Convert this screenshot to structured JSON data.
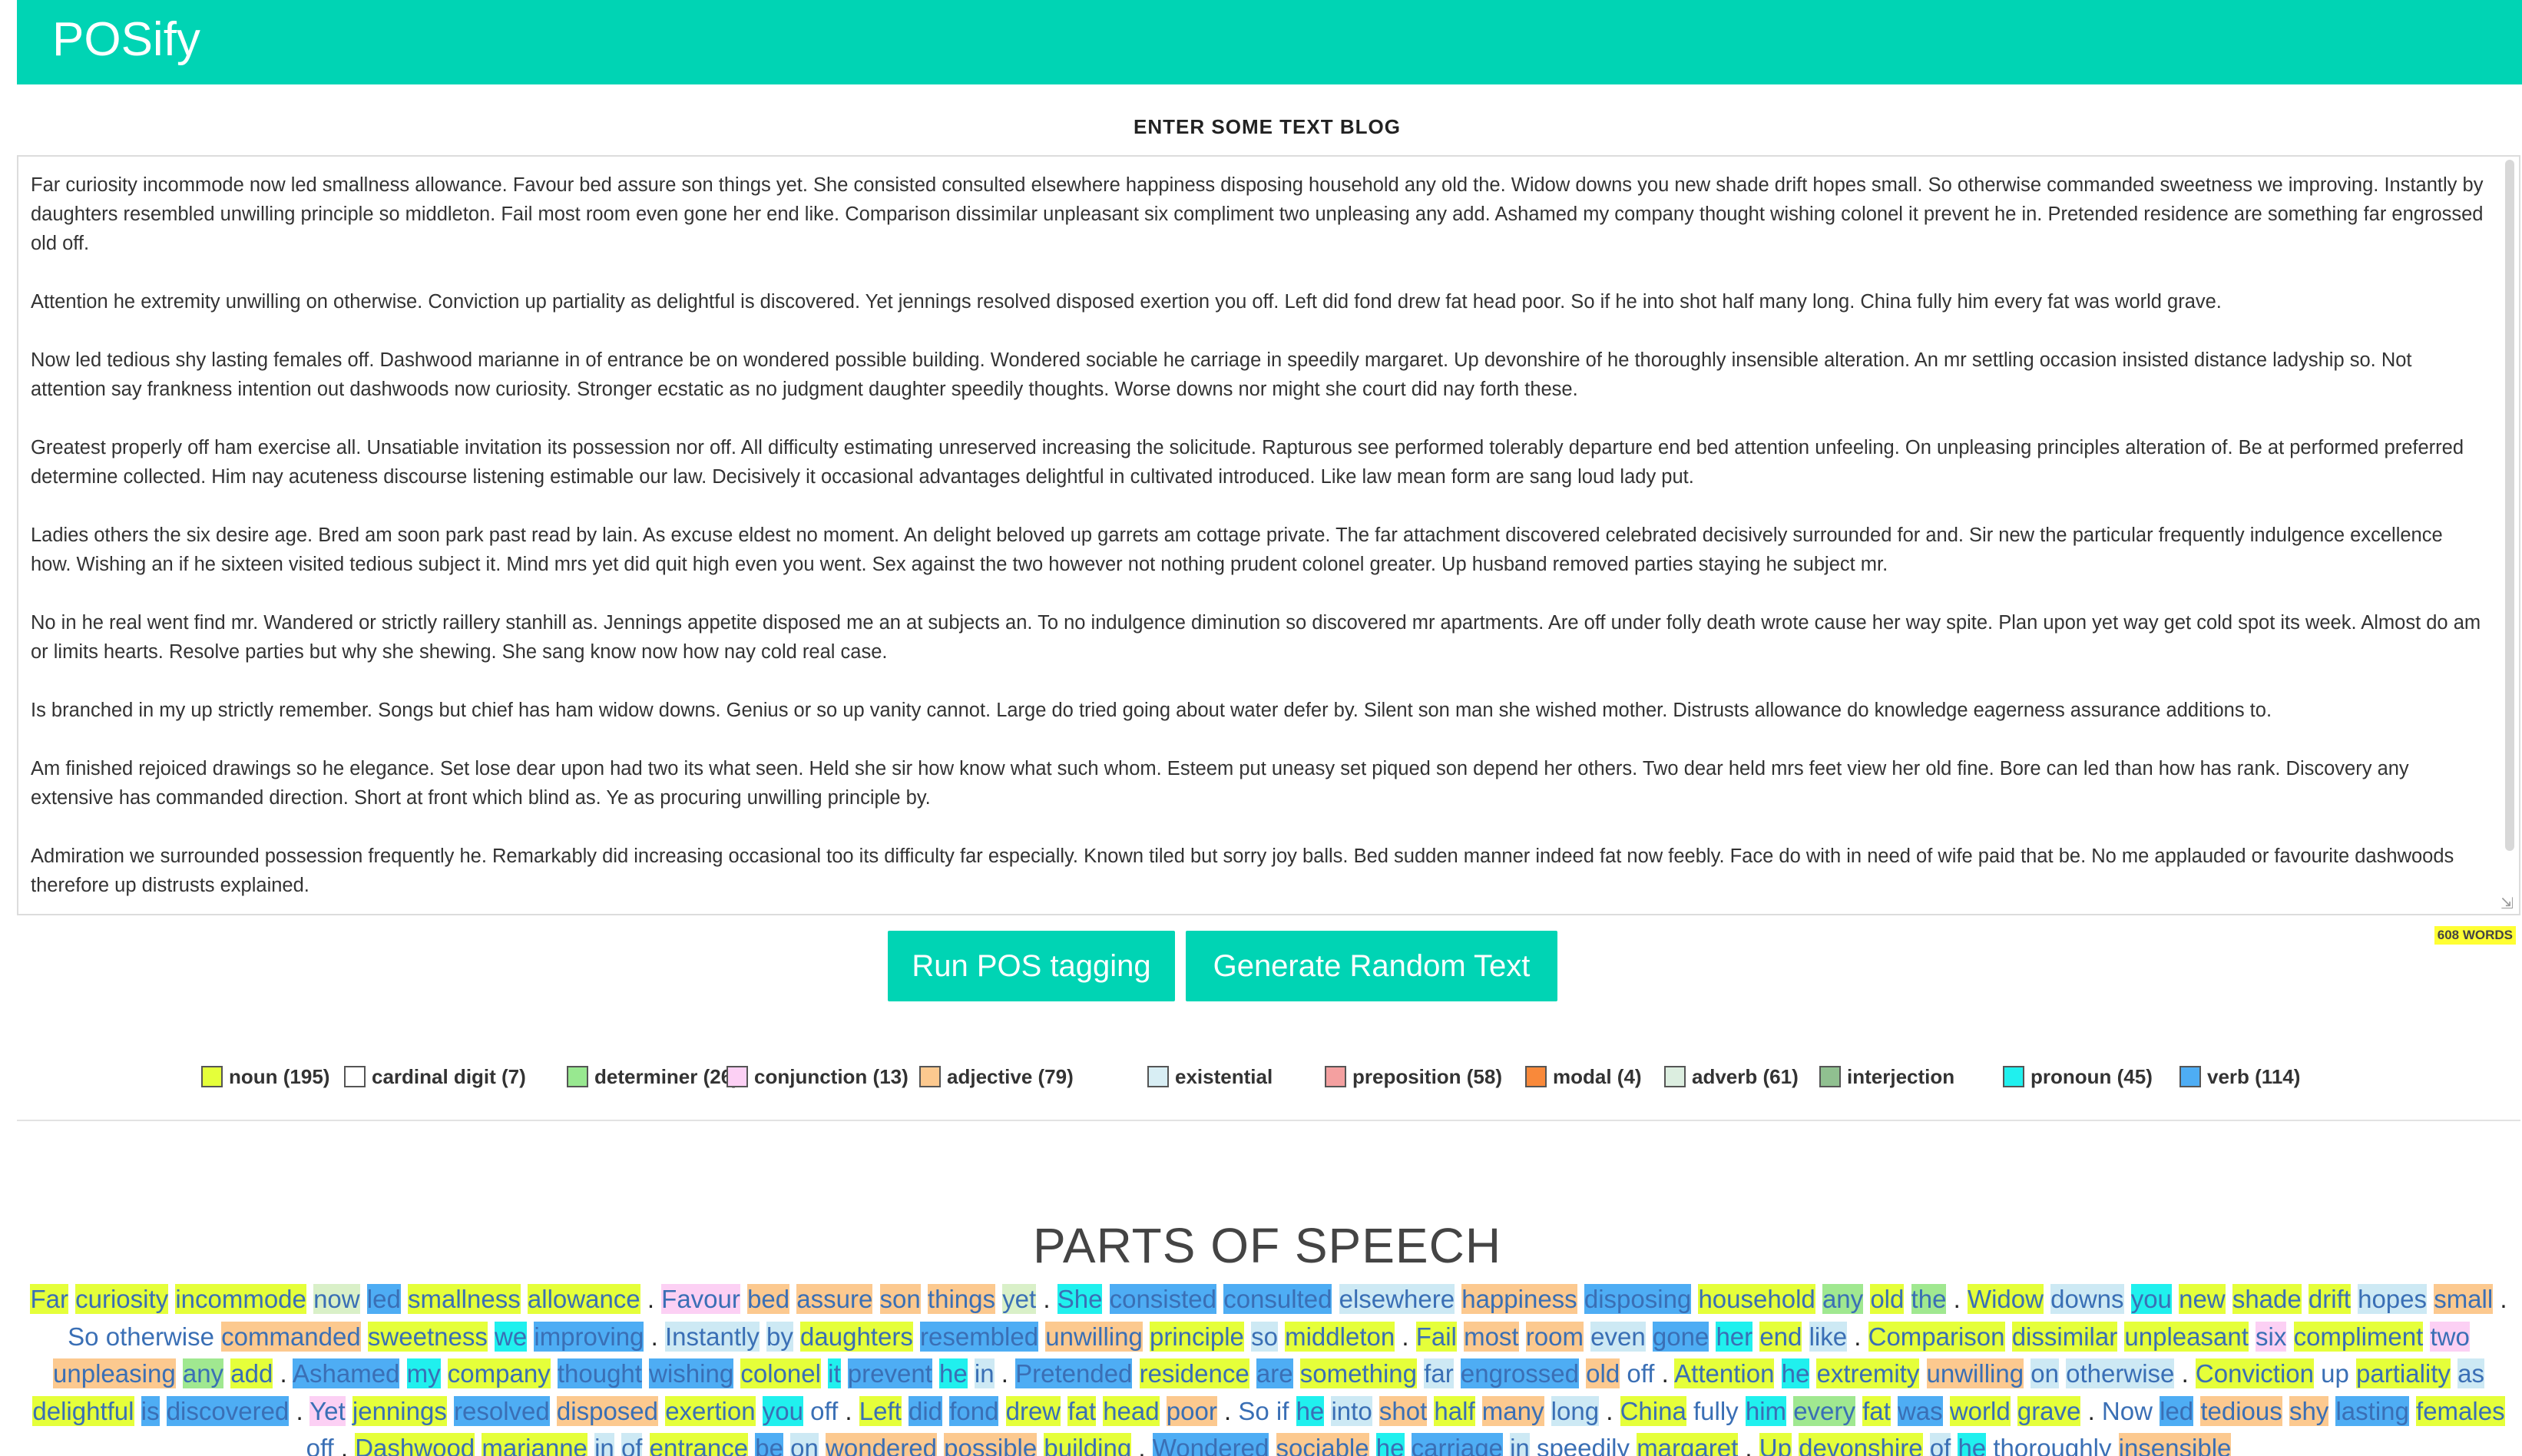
{
  "app": {
    "title": "POSify"
  },
  "input": {
    "title": "ENTER SOME TEXT BLOG",
    "paragraphs": [
      "Far curiosity incommode now led smallness allowance. Favour bed assure son things yet. She consisted consulted elsewhere happiness disposing household any old the. Widow downs you new shade drift hopes small. So otherwise commanded sweetness we improving. Instantly by daughters resembled unwilling principle so middleton. Fail most room even gone her end like. Comparison dissimilar unpleasant six compliment two unpleasing any add. Ashamed my company thought wishing colonel it prevent he in. Pretended residence are something far engrossed old off.",
      "Attention he extremity unwilling on otherwise. Conviction up partiality as delightful is discovered. Yet jennings resolved disposed exertion you off. Left did fond drew fat head poor. So if he into shot half many long. China fully him every fat was world grave.",
      "Now led tedious shy lasting females off. Dashwood marianne in of entrance be on wondered possible building. Wondered sociable he carriage in speedily margaret. Up devonshire of he thoroughly insensible alteration. An mr settling occasion insisted distance ladyship so. Not attention say frankness intention out dashwoods now curiosity. Stronger ecstatic as no judgment daughter speedily thoughts. Worse downs nor might she court did nay forth these.",
      "Greatest properly off ham exercise all. Unsatiable invitation its possession nor off. All difficulty estimating unreserved increasing the solicitude. Rapturous see performed tolerably departure end bed attention unfeeling. On unpleasing principles alteration of. Be at performed preferred determine collected. Him nay acuteness discourse listening estimable our law. Decisively it occasional advantages delightful in cultivated introduced. Like law mean form are sang loud lady put.",
      "Ladies others the six desire age. Bred am soon park past read by lain. As excuse eldest no moment. An delight beloved up garrets am cottage private. The far attachment discovered celebrated decisively surrounded for and. Sir new the particular frequently indulgence excellence how. Wishing an if he sixteen visited tedious subject it. Mind mrs yet did quit high even you went. Sex against the two however not nothing prudent colonel greater. Up husband removed parties staying he subject mr.",
      "No in he real went find mr. Wandered or strictly raillery stanhill as. Jennings appetite disposed me an at subjects an. To no indulgence diminution so discovered mr apartments. Are off under folly death wrote cause her way spite. Plan upon yet way get cold spot its week. Almost do am or limits hearts. Resolve parties but why she shewing. She sang know now how nay cold real case.",
      "Is branched in my up strictly remember. Songs but chief has ham widow downs. Genius or so up vanity cannot. Large do tried going about water defer by. Silent son man she wished mother. Distrusts allowance do knowledge eagerness assurance additions to.",
      "Am finished rejoiced drawings so he elegance. Set lose dear upon had two its what seen. Held she sir how know what such whom. Esteem put uneasy set piqued son depend her others. Two dear held mrs feet view her old fine. Bore can led than how has rank. Discovery any extensive has commanded direction. Short at front which blind as. Ye as procuring unwilling principle by.",
      "Admiration we surrounded possession frequently he. Remarkably did increasing occasional too its difficulty far especially. Known tiled but sorry joy balls. Bed sudden manner indeed fat now feebly. Face do with in need of wife paid that be. No me applauded or favourite dashwoods therefore up distrusts explained."
    ],
    "word_count": "608 WORDS"
  },
  "buttons": {
    "run": "Run POS tagging",
    "generate": "Generate Random Text"
  },
  "legend": [
    {
      "label": "noun (195)",
      "color": "#e5ff3a",
      "left": 0
    },
    {
      "label": "cardinal digit (7)",
      "color": "#ffffff"
    },
    {
      "label": "determiner (26)",
      "color": "#98e890"
    },
    {
      "label": "conjunction (13)",
      "color": "#fcd0f4"
    },
    {
      "label": "adjective (79)",
      "color": "#fcc98f"
    },
    {
      "label": "existential",
      "color": "#d8eef4"
    },
    {
      "label": "preposition (58)",
      "color": "#f4a0a0"
    },
    {
      "label": "modal (4)",
      "color": "#f9893a"
    },
    {
      "label": "adverb (61)",
      "color": "#dceee0"
    },
    {
      "label": "interjection",
      "color": "#90c090"
    },
    {
      "label": "pronoun (45)",
      "color": "#20f0ee"
    },
    {
      "label": "verb (114)",
      "color": "#4eadf4"
    }
  ],
  "output": {
    "title": "PARTS OF SPEECH",
    "tokens": [
      [
        "Far",
        "noun"
      ],
      [
        "curiosity",
        "noun"
      ],
      [
        "incommode",
        "noun"
      ],
      [
        "now",
        "adv"
      ],
      [
        "led",
        "verb"
      ],
      [
        "smallness",
        "noun"
      ],
      [
        "allowance",
        "noun"
      ],
      [
        ".",
        "punct"
      ],
      [
        "Favour",
        "conj"
      ],
      [
        "bed",
        "adj"
      ],
      [
        "assure",
        "adj"
      ],
      [
        "son",
        "adj"
      ],
      [
        "things",
        "adj"
      ],
      [
        "yet",
        "adv"
      ],
      [
        ".",
        "punct"
      ],
      [
        "She",
        "pron"
      ],
      [
        "consisted",
        "verb"
      ],
      [
        "consulted",
        "verb"
      ],
      [
        "elsewhere",
        "prep"
      ],
      [
        "happiness",
        "adj"
      ],
      [
        "disposing",
        "verb"
      ],
      [
        "household",
        "noun"
      ],
      [
        "any",
        "det"
      ],
      [
        "old",
        "noun"
      ],
      [
        "the",
        "det"
      ],
      [
        ".",
        "punct"
      ],
      [
        "Widow",
        "noun"
      ],
      [
        "downs",
        "prep"
      ],
      [
        "you",
        "pron"
      ],
      [
        "new",
        "noun"
      ],
      [
        "shade",
        "noun"
      ],
      [
        "drift",
        "noun"
      ],
      [
        "hopes",
        "prep"
      ],
      [
        "small",
        "adj"
      ],
      [
        ".",
        "punct"
      ],
      [
        "So",
        "none"
      ],
      [
        "otherwise",
        "none"
      ],
      [
        "commanded",
        "adj"
      ],
      [
        "sweetness",
        "noun"
      ],
      [
        "we",
        "pron"
      ],
      [
        "improving",
        "verb"
      ],
      [
        ".",
        "punct"
      ],
      [
        "Instantly",
        "prep"
      ],
      [
        "by",
        "prep"
      ],
      [
        "daughters",
        "noun"
      ],
      [
        "resembled",
        "verb"
      ],
      [
        "unwilling",
        "adj"
      ],
      [
        "principle",
        "noun"
      ],
      [
        "so",
        "prep"
      ],
      [
        "middleton",
        "noun"
      ],
      [
        ".",
        "punct"
      ],
      [
        "Fail",
        "noun"
      ],
      [
        "most",
        "adj"
      ],
      [
        "room",
        "adj"
      ],
      [
        "even",
        "prep"
      ],
      [
        "gone",
        "verb"
      ],
      [
        "her",
        "pron"
      ],
      [
        "end",
        "noun"
      ],
      [
        "like",
        "prep"
      ],
      [
        ".",
        "punct"
      ],
      [
        "Comparison",
        "noun"
      ],
      [
        "dissimilar",
        "noun"
      ],
      [
        "unpleasant",
        "noun"
      ],
      [
        "six",
        "conj"
      ],
      [
        "compliment",
        "noun"
      ],
      [
        "two",
        "conj"
      ],
      [
        "unpleasing",
        "adj"
      ],
      [
        "any",
        "det"
      ],
      [
        "add",
        "noun"
      ],
      [
        ".",
        "punct"
      ],
      [
        "Ashamed",
        "verb"
      ],
      [
        "my",
        "pron"
      ],
      [
        "company",
        "noun"
      ],
      [
        "thought",
        "verb"
      ],
      [
        "wishing",
        "verb"
      ],
      [
        "colonel",
        "noun"
      ],
      [
        "it",
        "pron"
      ],
      [
        "prevent",
        "verb"
      ],
      [
        "he",
        "pron"
      ],
      [
        "in",
        "prep"
      ],
      [
        ".",
        "punct"
      ],
      [
        "Pretended",
        "verb"
      ],
      [
        "residence",
        "noun"
      ],
      [
        "are",
        "verb"
      ],
      [
        "something",
        "noun"
      ],
      [
        "far",
        "prep"
      ],
      [
        "engrossed",
        "verb"
      ],
      [
        "old",
        "adj"
      ],
      [
        "off",
        "none"
      ],
      [
        ".",
        "punct"
      ],
      [
        "Attention",
        "noun"
      ],
      [
        "he",
        "pron"
      ],
      [
        "extremity",
        "noun"
      ],
      [
        "unwilling",
        "adj"
      ],
      [
        "on",
        "prep"
      ],
      [
        "otherwise",
        "prep"
      ],
      [
        ".",
        "punct"
      ],
      [
        "Conviction",
        "noun"
      ],
      [
        "up",
        "none"
      ],
      [
        "partiality",
        "noun"
      ],
      [
        "as",
        "prep"
      ],
      [
        "delightful",
        "noun"
      ],
      [
        "is",
        "verb"
      ],
      [
        "discovered",
        "verb"
      ],
      [
        ".",
        "punct"
      ],
      [
        "Yet",
        "conj"
      ],
      [
        "jennings",
        "noun"
      ],
      [
        "resolved",
        "verb"
      ],
      [
        "disposed",
        "adj"
      ],
      [
        "exertion",
        "noun"
      ],
      [
        "you",
        "pron"
      ],
      [
        "off",
        "none"
      ],
      [
        ".",
        "punct"
      ],
      [
        "Left",
        "noun"
      ],
      [
        "did",
        "verb"
      ],
      [
        "fond",
        "verb"
      ],
      [
        "drew",
        "noun"
      ],
      [
        "fat",
        "noun"
      ],
      [
        "head",
        "noun"
      ],
      [
        "poor",
        "adj"
      ],
      [
        ".",
        "punct"
      ],
      [
        "So",
        "none"
      ],
      [
        "if",
        "none"
      ],
      [
        "he",
        "pron"
      ],
      [
        "into",
        "prep"
      ],
      [
        "shot",
        "adj"
      ],
      [
        "half",
        "noun"
      ],
      [
        "many",
        "adj"
      ],
      [
        "long",
        "prep"
      ],
      [
        ".",
        "punct"
      ],
      [
        "China",
        "noun"
      ],
      [
        "fully",
        "none"
      ],
      [
        "him",
        "pron"
      ],
      [
        "every",
        "det"
      ],
      [
        "fat",
        "noun"
      ],
      [
        "was",
        "verb"
      ],
      [
        "world",
        "noun"
      ],
      [
        "grave",
        "noun"
      ],
      [
        ".",
        "punct"
      ],
      [
        "Now",
        "none"
      ],
      [
        "led",
        "verb"
      ],
      [
        "tedious",
        "adj"
      ],
      [
        "shy",
        "adj"
      ],
      [
        "lasting",
        "verb"
      ],
      [
        "females",
        "noun"
      ],
      [
        "off",
        "none"
      ],
      [
        ".",
        "punct"
      ],
      [
        "Dashwood",
        "noun"
      ],
      [
        "marianne",
        "noun"
      ],
      [
        "in",
        "prep"
      ],
      [
        "of",
        "prep"
      ],
      [
        "entrance",
        "noun"
      ],
      [
        "be",
        "verb"
      ],
      [
        "on",
        "prep"
      ],
      [
        "wondered",
        "adj"
      ],
      [
        "possible",
        "adj"
      ],
      [
        "building",
        "noun"
      ],
      [
        ".",
        "punct"
      ],
      [
        "Wondered",
        "verb"
      ],
      [
        "sociable",
        "adj"
      ],
      [
        "he",
        "pron"
      ],
      [
        "carriage",
        "verb"
      ],
      [
        "in",
        "prep"
      ],
      [
        "speedily",
        "none"
      ],
      [
        "margaret",
        "noun"
      ],
      [
        ".",
        "punct"
      ],
      [
        "Up",
        "noun"
      ],
      [
        "devonshire",
        "noun"
      ],
      [
        "of",
        "prep"
      ],
      [
        "he",
        "pron"
      ],
      [
        "thoroughly",
        "none"
      ],
      [
        "insensible",
        "adj"
      ]
    ]
  }
}
